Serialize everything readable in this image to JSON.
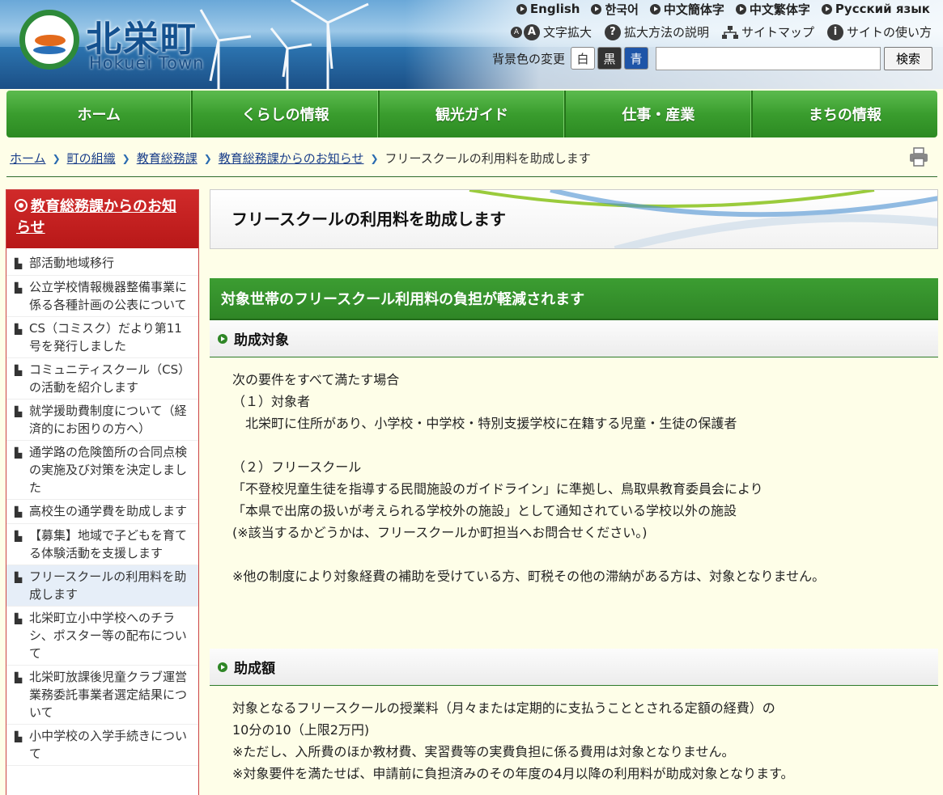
{
  "header": {
    "logo_jp": "北栄町",
    "logo_en": "Hokuei Town",
    "languages": [
      "English",
      "한국어",
      "中文簡体字",
      "中文繁体字",
      "Русский язык"
    ],
    "tools": {
      "enlarge": "文字拡大",
      "enlarge_help": "拡大方法の説明",
      "sitemap": "サイトマップ",
      "howto": "サイトの使い方"
    },
    "color_change_label": "背景色の変更",
    "color_options": [
      "白",
      "黒",
      "青"
    ],
    "search": {
      "value": "",
      "button": "検索"
    }
  },
  "nav": [
    "ホーム",
    "くらしの情報",
    "観光ガイド",
    "仕事・産業",
    "まちの情報"
  ],
  "breadcrumb": {
    "links": [
      "ホーム",
      "町の組織",
      "教育総務課",
      "教育総務課からのお知らせ"
    ],
    "current": "フリースクールの利用料を助成します"
  },
  "sidebar": {
    "heading": "教育総務課からのお知らせ",
    "items": [
      "部活動地域移行",
      "公立学校情報機器整備事業に係る各種計画の公表について",
      "CS（コミスク）だより第11号を発行しました",
      "コミュニティスクール（CS）の活動を紹介します",
      "就学援助費制度について（経済的にお困りの方へ）",
      "通学路の危険箇所の合同点検の実施及び対策を決定しました",
      "高校生の通学費を助成します",
      "【募集】地域で子どもを育てる体験活動を支援します",
      "フリースクールの利用料を助成します",
      "北栄町立小中学校へのチラシ、ポスター等の配布について",
      "北栄町放課後児童クラブ運営業務委託事業者選定結果について",
      "小中学校の入学手続きについて"
    ]
  },
  "main": {
    "title": "フリースクールの利用料を助成します",
    "h2": "対象世帯のフリースクール利用料の負担が軽減されます",
    "section1": {
      "heading": "助成対象",
      "lines": [
        "次の要件をすべて満たす場合",
        "（１）対象者",
        "　北栄町に住所があり、小学校・中学校・特別支援学校に在籍する児童・生徒の保護者",
        "",
        "（２）フリースクール",
        "「不登校児童生徒を指導する民間施設のガイドライン」に準拠し、鳥取県教育委員会により",
        "「本県で出席の扱いが考えられる学校外の施設」として通知されている学校以外の施設",
        "(※該当するかどうかは、フリースクールか町担当へお問合せください。)",
        "",
        "※他の制度により対象経費の補助を受けている方、町税その他の滞納がある方は、対象となりません。"
      ]
    },
    "section2": {
      "heading": "助成額",
      "lines": [
        "対象となるフリースクールの授業料（月々または定期的に支払うこととされる定額の経費）の",
        "10分の10（上限2万円)",
        "※ただし、入所費のほか教材費、実習費等の実費負担に係る費用は対象となりません。",
        "※対象要件を満たせば、申請前に負担済みのその年度の4月以降の利用料が助成対象となります。"
      ]
    }
  }
}
